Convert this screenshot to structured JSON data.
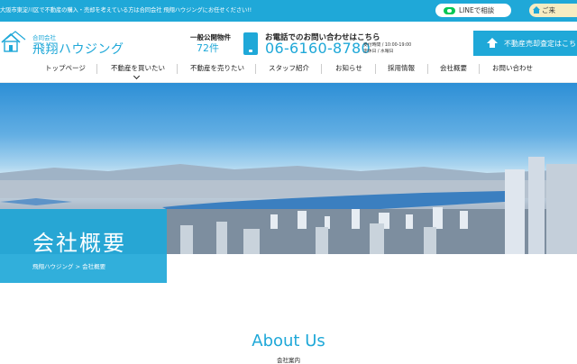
{
  "topbar": {
    "message": "大阪市東淀川区で不動産の購入・売却を考えている方は合同会社 飛翔ハウジングにお任せください!!",
    "line_button": "LINEで相談",
    "home_button": "ご来",
    "colors": {
      "bar": "#1fa8d8",
      "line_green": "#06c755",
      "home_pill": "#f6ecc2"
    }
  },
  "header": {
    "logo_icon": "house-logo-icon",
    "company_type": "合同会社",
    "company_name": "飛翔ハウジング",
    "stock_label": "一般公開物件",
    "stock_count": "72件",
    "contact_label": "お電話でのお問い合わせはこちら",
    "phone": "06-6160-8780",
    "hours_line1": "受付時間 / 10:00-19:00",
    "hours_line2": "定休日 / 水曜日",
    "assess_button": "不動産売却査定はこち"
  },
  "nav": {
    "items": [
      {
        "label": "トップページ"
      },
      {
        "label": "不動産を買いたい"
      },
      {
        "label": "不動産を売りたい"
      },
      {
        "label": "スタッフ紹介"
      },
      {
        "label": "お知らせ"
      },
      {
        "label": "採用情報"
      },
      {
        "label": "会社概要"
      },
      {
        "label": "お問い合わせ"
      }
    ]
  },
  "hero": {
    "title": "会社概要",
    "breadcrumb": "飛翔ハウジング > 会社概要"
  },
  "about": {
    "heading": "About Us",
    "subheading": "会社案内"
  }
}
